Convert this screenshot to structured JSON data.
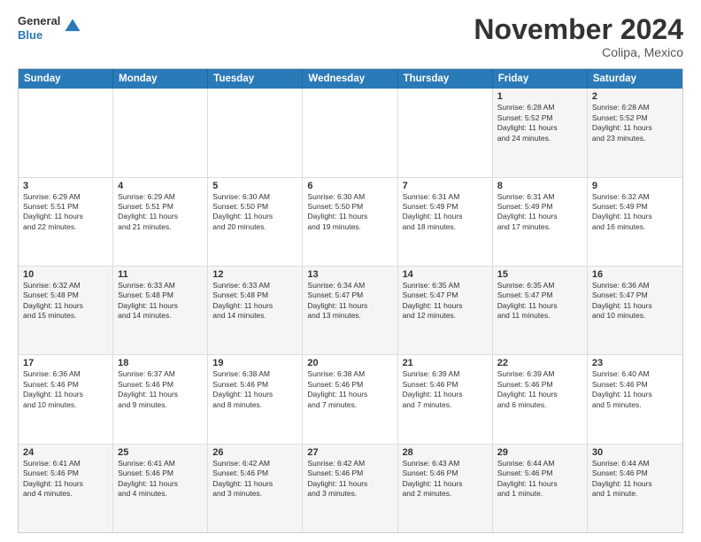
{
  "header": {
    "logo_general": "General",
    "logo_blue": "Blue",
    "month_title": "November 2024",
    "subtitle": "Colipa, Mexico"
  },
  "weekdays": [
    "Sunday",
    "Monday",
    "Tuesday",
    "Wednesday",
    "Thursday",
    "Friday",
    "Saturday"
  ],
  "rows": [
    [
      {
        "day": "",
        "info": ""
      },
      {
        "day": "",
        "info": ""
      },
      {
        "day": "",
        "info": ""
      },
      {
        "day": "",
        "info": ""
      },
      {
        "day": "",
        "info": ""
      },
      {
        "day": "1",
        "info": "Sunrise: 6:28 AM\nSunset: 5:52 PM\nDaylight: 11 hours\nand 24 minutes."
      },
      {
        "day": "2",
        "info": "Sunrise: 6:28 AM\nSunset: 5:52 PM\nDaylight: 11 hours\nand 23 minutes."
      }
    ],
    [
      {
        "day": "3",
        "info": "Sunrise: 6:29 AM\nSunset: 5:51 PM\nDaylight: 11 hours\nand 22 minutes."
      },
      {
        "day": "4",
        "info": "Sunrise: 6:29 AM\nSunset: 5:51 PM\nDaylight: 11 hours\nand 21 minutes."
      },
      {
        "day": "5",
        "info": "Sunrise: 6:30 AM\nSunset: 5:50 PM\nDaylight: 11 hours\nand 20 minutes."
      },
      {
        "day": "6",
        "info": "Sunrise: 6:30 AM\nSunset: 5:50 PM\nDaylight: 11 hours\nand 19 minutes."
      },
      {
        "day": "7",
        "info": "Sunrise: 6:31 AM\nSunset: 5:49 PM\nDaylight: 11 hours\nand 18 minutes."
      },
      {
        "day": "8",
        "info": "Sunrise: 6:31 AM\nSunset: 5:49 PM\nDaylight: 11 hours\nand 17 minutes."
      },
      {
        "day": "9",
        "info": "Sunrise: 6:32 AM\nSunset: 5:49 PM\nDaylight: 11 hours\nand 16 minutes."
      }
    ],
    [
      {
        "day": "10",
        "info": "Sunrise: 6:32 AM\nSunset: 5:48 PM\nDaylight: 11 hours\nand 15 minutes."
      },
      {
        "day": "11",
        "info": "Sunrise: 6:33 AM\nSunset: 5:48 PM\nDaylight: 11 hours\nand 14 minutes."
      },
      {
        "day": "12",
        "info": "Sunrise: 6:33 AM\nSunset: 5:48 PM\nDaylight: 11 hours\nand 14 minutes."
      },
      {
        "day": "13",
        "info": "Sunrise: 6:34 AM\nSunset: 5:47 PM\nDaylight: 11 hours\nand 13 minutes."
      },
      {
        "day": "14",
        "info": "Sunrise: 6:35 AM\nSunset: 5:47 PM\nDaylight: 11 hours\nand 12 minutes."
      },
      {
        "day": "15",
        "info": "Sunrise: 6:35 AM\nSunset: 5:47 PM\nDaylight: 11 hours\nand 11 minutes."
      },
      {
        "day": "16",
        "info": "Sunrise: 6:36 AM\nSunset: 5:47 PM\nDaylight: 11 hours\nand 10 minutes."
      }
    ],
    [
      {
        "day": "17",
        "info": "Sunrise: 6:36 AM\nSunset: 5:46 PM\nDaylight: 11 hours\nand 10 minutes."
      },
      {
        "day": "18",
        "info": "Sunrise: 6:37 AM\nSunset: 5:46 PM\nDaylight: 11 hours\nand 9 minutes."
      },
      {
        "day": "19",
        "info": "Sunrise: 6:38 AM\nSunset: 5:46 PM\nDaylight: 11 hours\nand 8 minutes."
      },
      {
        "day": "20",
        "info": "Sunrise: 6:38 AM\nSunset: 5:46 PM\nDaylight: 11 hours\nand 7 minutes."
      },
      {
        "day": "21",
        "info": "Sunrise: 6:39 AM\nSunset: 5:46 PM\nDaylight: 11 hours\nand 7 minutes."
      },
      {
        "day": "22",
        "info": "Sunrise: 6:39 AM\nSunset: 5:46 PM\nDaylight: 11 hours\nand 6 minutes."
      },
      {
        "day": "23",
        "info": "Sunrise: 6:40 AM\nSunset: 5:46 PM\nDaylight: 11 hours\nand 5 minutes."
      }
    ],
    [
      {
        "day": "24",
        "info": "Sunrise: 6:41 AM\nSunset: 5:46 PM\nDaylight: 11 hours\nand 4 minutes."
      },
      {
        "day": "25",
        "info": "Sunrise: 6:41 AM\nSunset: 5:46 PM\nDaylight: 11 hours\nand 4 minutes."
      },
      {
        "day": "26",
        "info": "Sunrise: 6:42 AM\nSunset: 5:46 PM\nDaylight: 11 hours\nand 3 minutes."
      },
      {
        "day": "27",
        "info": "Sunrise: 6:42 AM\nSunset: 5:46 PM\nDaylight: 11 hours\nand 3 minutes."
      },
      {
        "day": "28",
        "info": "Sunrise: 6:43 AM\nSunset: 5:46 PM\nDaylight: 11 hours\nand 2 minutes."
      },
      {
        "day": "29",
        "info": "Sunrise: 6:44 AM\nSunset: 5:46 PM\nDaylight: 11 hours\nand 1 minute."
      },
      {
        "day": "30",
        "info": "Sunrise: 6:44 AM\nSunset: 5:46 PM\nDaylight: 11 hours\nand 1 minute."
      }
    ]
  ]
}
